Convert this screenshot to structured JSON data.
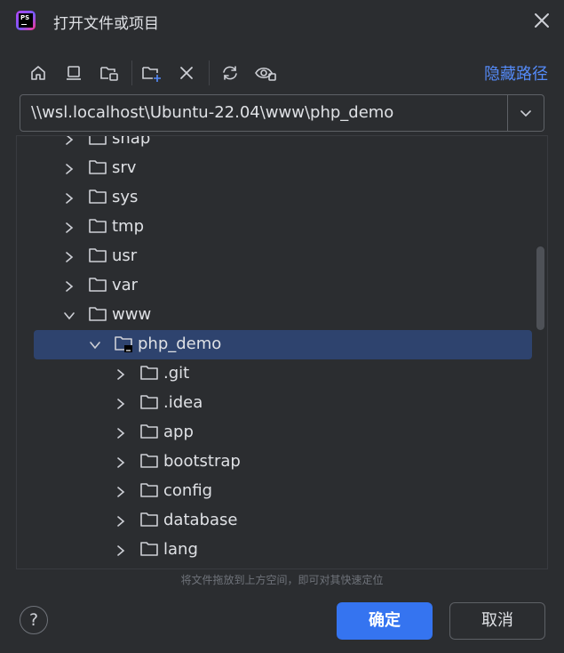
{
  "window": {
    "title": "打开文件或项目",
    "app_logo_text": "PS"
  },
  "toolbar": {
    "icons": [
      "home-icon",
      "desktop-icon",
      "project-folder-icon",
      "new-folder-icon",
      "delete-icon",
      "refresh-icon",
      "show-hidden-icon"
    ],
    "hide_path_label": "隐藏路径"
  },
  "path": {
    "value": "\\\\wsl.localhost\\Ubuntu-22.04\\www\\php_demo"
  },
  "tree": {
    "rows": [
      {
        "label": "snap",
        "expanded": false
      },
      {
        "label": "srv",
        "expanded": false
      },
      {
        "label": "sys",
        "expanded": false
      },
      {
        "label": "tmp",
        "expanded": false
      },
      {
        "label": "usr",
        "expanded": false
      },
      {
        "label": "var",
        "expanded": false
      },
      {
        "label": "www",
        "expanded": true
      },
      {
        "label": "php_demo",
        "expanded": true,
        "selected": true
      },
      {
        "label": ".git",
        "expanded": false
      },
      {
        "label": ".idea",
        "expanded": false
      },
      {
        "label": "app",
        "expanded": false
      },
      {
        "label": "bootstrap",
        "expanded": false
      },
      {
        "label": "config",
        "expanded": false
      },
      {
        "label": "database",
        "expanded": false
      },
      {
        "label": "lang",
        "expanded": false
      }
    ]
  },
  "hint": "将文件拖放到上方空间，即可对其快速定位",
  "footer": {
    "help_label": "?",
    "ok_label": "确定",
    "cancel_label": "取消"
  },
  "colors": {
    "accent": "#3574f0",
    "link": "#548af7",
    "selection": "#2e436e",
    "background": "#2b2d30"
  }
}
